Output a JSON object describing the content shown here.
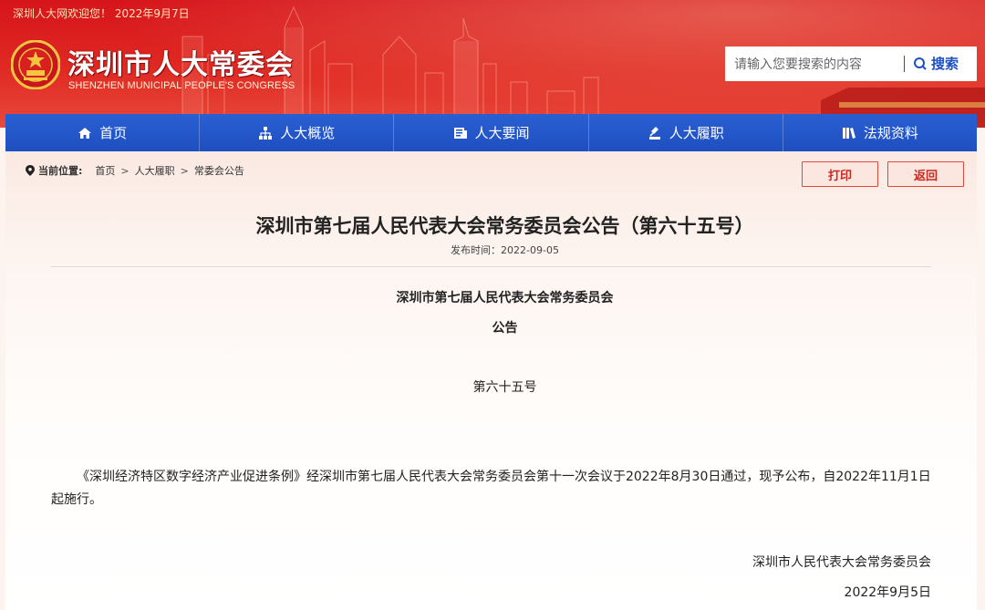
{
  "header": {
    "welcome": "深圳人大网欢迎您！ 2022年9月7日",
    "site_title": "深圳市人大常委会",
    "site_subtitle": "SHENZHEN MUNICIPAL PEOPLE'S CONGRESS",
    "search": {
      "placeholder": "请输入您要搜索的内容",
      "button_label": "搜索"
    }
  },
  "nav": {
    "items": [
      {
        "label": "首页",
        "icon": "home-icon"
      },
      {
        "label": "人大概览",
        "icon": "org-chart-icon"
      },
      {
        "label": "人大要闻",
        "icon": "news-icon"
      },
      {
        "label": "人大履职",
        "icon": "duty-icon"
      },
      {
        "label": "法规资料",
        "icon": "books-icon"
      }
    ]
  },
  "breadcrumb": {
    "label": "当前位置:",
    "items": [
      "首页",
      "人大履职",
      "常委会公告"
    ]
  },
  "actions": {
    "print": "打印",
    "back": "返回"
  },
  "article": {
    "title": "深圳市第七届人民代表大会常务委员会公告（第六十五号）",
    "publish_time": "发布时间：2022-09-05",
    "issuer": "深圳市第七届人民代表大会常务委员会",
    "doc_type": "公告",
    "number": "第六十五号",
    "body": "《深圳经济特区数字经济产业促进条例》经深圳市第七届人民代表大会常务委员会第十一次会议于2022年8月30日通过，现予公布，自2022年11月1日起施行。",
    "signature": "深圳市人民代表大会常务委员会",
    "sign_date": "2022年9月5日"
  },
  "colors": {
    "banner_red": "#d6141b",
    "nav_blue": "#1e4fc0",
    "button_border": "#d94a3c"
  }
}
